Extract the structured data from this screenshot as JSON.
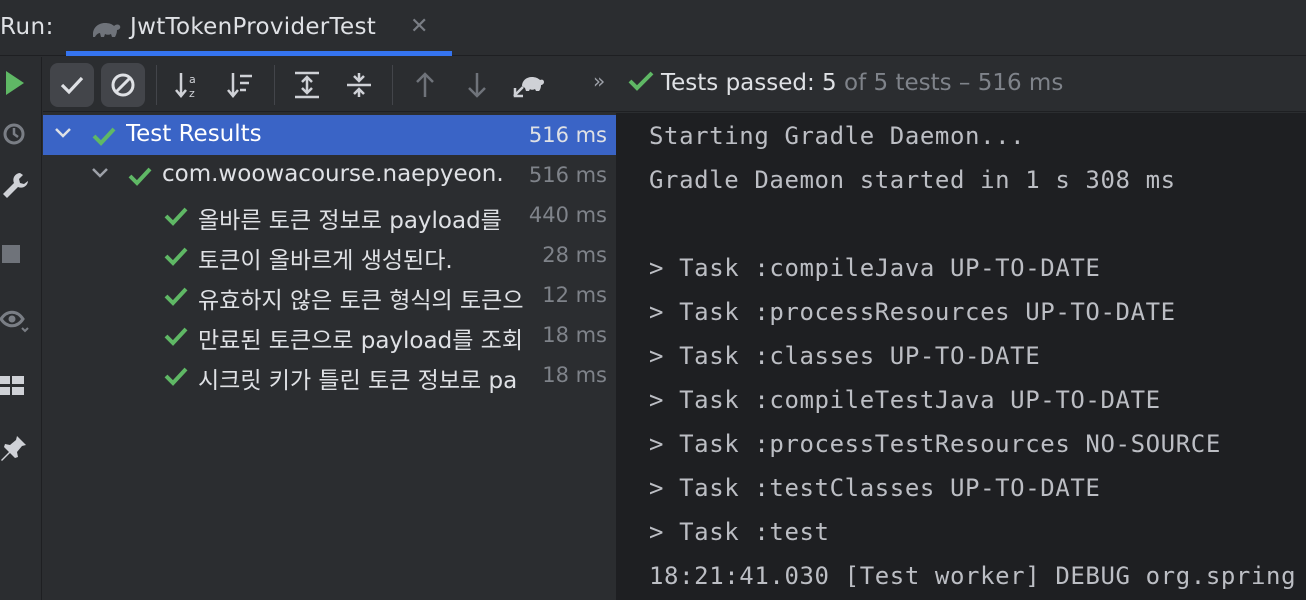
{
  "run_panel": {
    "label": "Run:",
    "tab": {
      "title": "JwtTokenProviderTest",
      "icon": "gradle-elephant-icon"
    }
  },
  "toolbar": {
    "status_passed": "Tests passed: 5",
    "status_of": " of 5 tests – 516 ms"
  },
  "tree": {
    "root": {
      "label": "Test Results",
      "time": "516 ms"
    },
    "suite": {
      "label": "com.woowacourse.naepyeon.",
      "time": "516 ms"
    },
    "tests": [
      {
        "label": "올바른 토큰 정보로 payload를",
        "time": "440 ms"
      },
      {
        "label": "토큰이 올바르게 생성된다.",
        "time": "28 ms"
      },
      {
        "label": "유효하지 않은 토큰 형식의 토큰으",
        "time": "12 ms"
      },
      {
        "label": "만료된 토큰으로 payload를 조회",
        "time": "18 ms"
      },
      {
        "label": "시크릿 키가 틀린 토큰 정보로 pa",
        "time": "18 ms"
      }
    ]
  },
  "console": {
    "lines": [
      "Starting Gradle Daemon...",
      "Gradle Daemon started in 1 s 308 ms",
      "",
      "> Task :compileJava UP-TO-DATE",
      "> Task :processResources UP-TO-DATE",
      "> Task :classes UP-TO-DATE",
      "> Task :compileTestJava UP-TO-DATE",
      "> Task :processTestResources NO-SOURCE",
      "> Task :testClasses UP-TO-DATE",
      "> Task :test",
      "18:21:41.030 [Test worker] DEBUG org.spring"
    ]
  },
  "colors": {
    "accent": "#3574f0",
    "pass_green": "#5fb865",
    "selection": "#3a64c6"
  }
}
